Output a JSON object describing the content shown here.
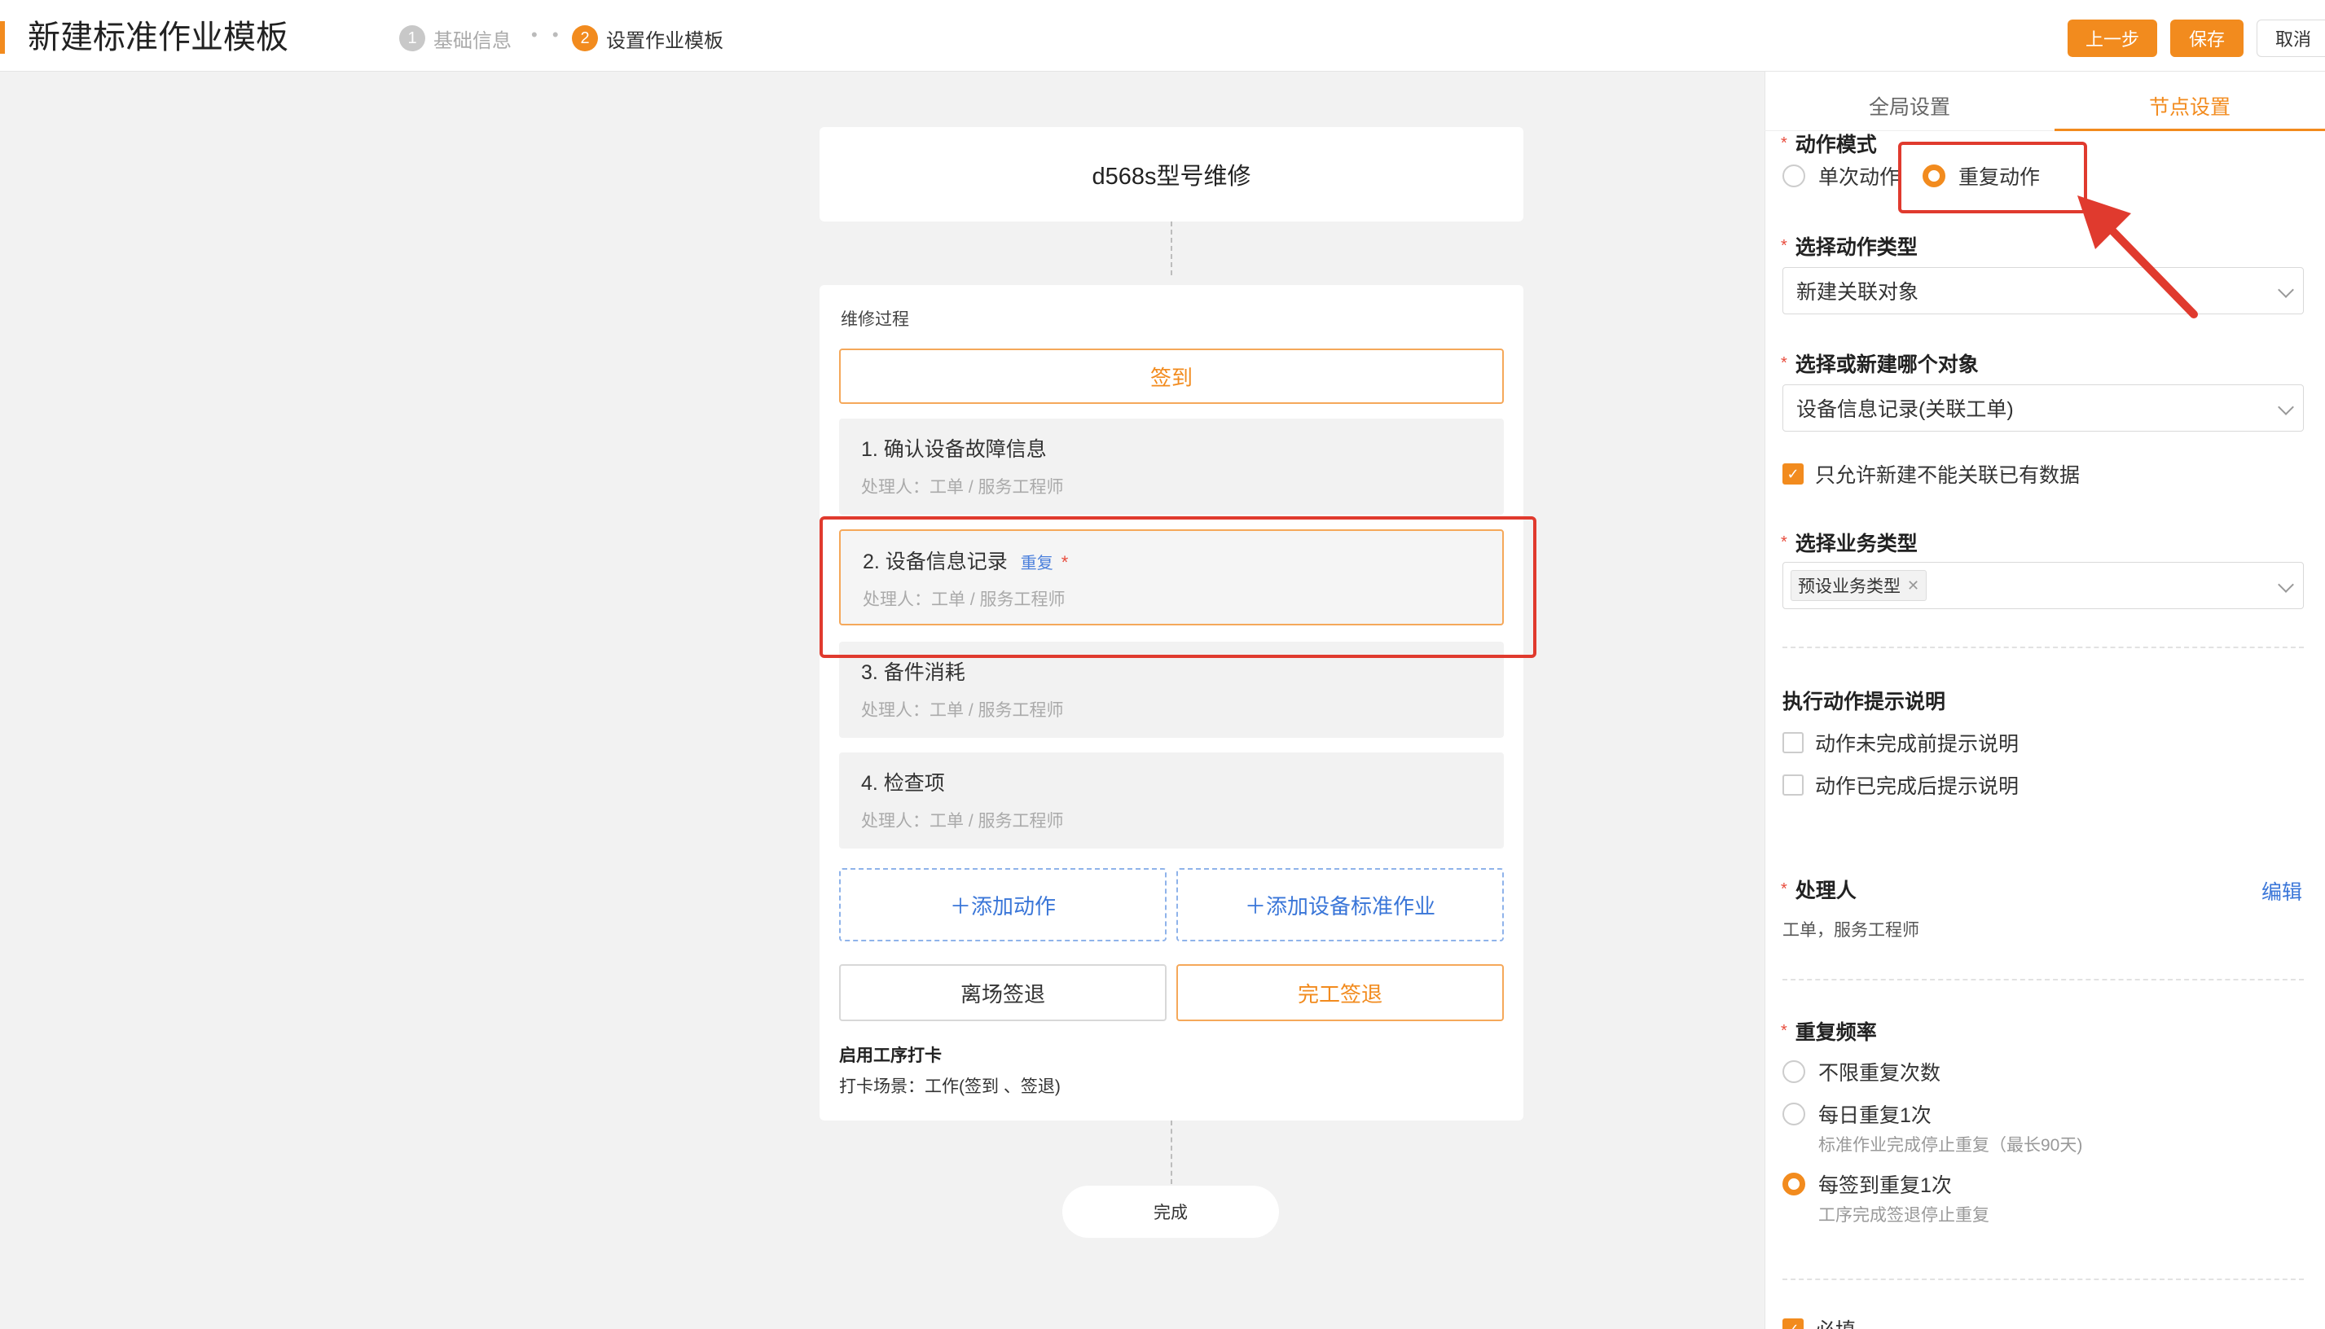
{
  "header": {
    "title": "新建标准作业模板",
    "steps": [
      {
        "num": "1",
        "label": "基础信息"
      },
      {
        "num": "2",
        "label": "设置作业模板"
      }
    ],
    "step_separator": "• •",
    "buttons": {
      "prev": "上一步",
      "save": "保存",
      "cancel": "取消"
    }
  },
  "canvas": {
    "root_title": "d568s型号维修",
    "process": {
      "title": "维修过程",
      "signin": "签到",
      "actions": [
        {
          "title": "1. 确认设备故障信息",
          "handler": "处理人：工单 / 服务工程师"
        },
        {
          "title": "2. 设备信息记录",
          "tag": "重复",
          "required": "*",
          "handler": "处理人：工单 / 服务工程师"
        },
        {
          "title": "3. 备件消耗",
          "handler": "处理人：工单 / 服务工程师"
        },
        {
          "title": "4. 检查项",
          "handler": "处理人：工单 / 服务工程师"
        }
      ],
      "add_action": "＋添加动作",
      "add_std": "＋添加设备标准作业",
      "leave": "离场签退",
      "finish": "完工签退",
      "clock_title": "启用工序打卡",
      "clock_scene": "打卡场景：工作(签到 、签退)"
    },
    "done": "完成"
  },
  "panel": {
    "tabs": [
      "全局设置",
      "节点设置"
    ],
    "active_tab": "节点设置",
    "action_mode": {
      "label": "动作模式",
      "options": [
        "单次动作",
        "重复动作"
      ],
      "selected": "重复动作"
    },
    "action_type": {
      "label": "选择动作类型",
      "value": "新建关联对象"
    },
    "object": {
      "label": "选择或新建哪个对象",
      "value": "设备信息记录(关联工单)"
    },
    "only_new": {
      "label": "只允许新建不能关联已有数据",
      "checked": true
    },
    "biz_type": {
      "label": "选择业务类型",
      "tag": "预设业务类型"
    },
    "hint": {
      "label": "执行动作提示说明",
      "before": "动作未完成前提示说明",
      "after": "动作已完成后提示说明"
    },
    "handler": {
      "label": "处理人",
      "edit": "编辑",
      "value": "工单，服务工程师"
    },
    "repeat": {
      "label": "重复频率",
      "options": [
        {
          "label": "不限重复次数"
        },
        {
          "label": "每日重复1次",
          "note": "标准作业完成停止重复（最长90天)"
        },
        {
          "label": "每签到重复1次",
          "note": "工序完成签退停止重复"
        }
      ],
      "selected": "每签到重复1次"
    },
    "required_check": "必填"
  },
  "colors": {
    "accent": "#f28b1e",
    "annotation": "#e03a2e",
    "link": "#3a76d8"
  }
}
